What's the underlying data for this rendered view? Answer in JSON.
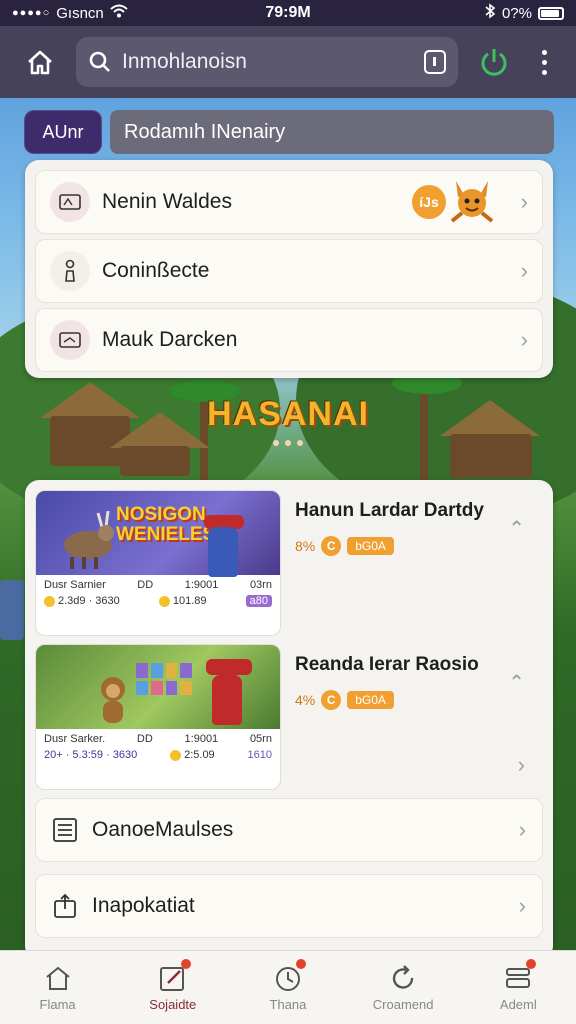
{
  "status_bar": {
    "carrier": "Gısncn",
    "time": "79:9M",
    "battery": "0?%",
    "battery_level": 0.9
  },
  "topbar": {
    "search_placeholder": "Inmohlanoisn"
  },
  "filter": {
    "pill_label": "AUnr",
    "input_text": "Rodamıh INenairy"
  },
  "menu": {
    "items": [
      {
        "label": "Nenin Waldes",
        "icon": "tablet-icon",
        "badge": "íJs"
      },
      {
        "label": "Coninßecte",
        "icon": "figure-icon"
      },
      {
        "label": "Mauk Darcken",
        "icon": "ticket-icon"
      }
    ]
  },
  "game_logo": {
    "title": "HASANAI"
  },
  "games": [
    {
      "thumb_title_line1": "NOSIGON",
      "thumb_title_line2": "WENIELES",
      "stats_name": "Dusr Sarnier",
      "stats_a1": "DD",
      "stats_a2": "1:9001",
      "stats_a3": "03rn",
      "stats_b1": "2.3d9 · 3630",
      "stats_b2": "101.89",
      "stats_b3": "a80",
      "title": "Hanun Lardar Dartdy",
      "pct": "8%",
      "coin_letter": "C",
      "tag": "bG0A"
    },
    {
      "thumb_title_line1": "",
      "thumb_title_line2": "",
      "stats_name": "Dusr Sarker.",
      "stats_a1": "DD",
      "stats_a2": "1:9001",
      "stats_a3": "05rn",
      "stats_b1": "20+ · 5.3:59 · 3630",
      "stats_b2": "2:5.09",
      "stats_b3": "1610",
      "title": "Reanda Ierar Raosio",
      "pct": "4%",
      "coin_letter": "C",
      "tag": "bG0A"
    }
  ],
  "list_rows": [
    {
      "label": "OanoeMaulses",
      "icon": "list-icon"
    },
    {
      "label": "Inapokatiat",
      "icon": "share-icon"
    }
  ],
  "bottom_nav": [
    {
      "label": "Flama",
      "icon": "home-icon",
      "badge": false
    },
    {
      "label": "Sojaidte",
      "icon": "edit-icon",
      "badge": true,
      "active": true
    },
    {
      "label": "Thana",
      "icon": "timer-icon",
      "badge": true
    },
    {
      "label": "Croamend",
      "icon": "refresh-icon",
      "badge": false
    },
    {
      "label": "Ademl",
      "icon": "stack-icon",
      "badge": true
    }
  ]
}
